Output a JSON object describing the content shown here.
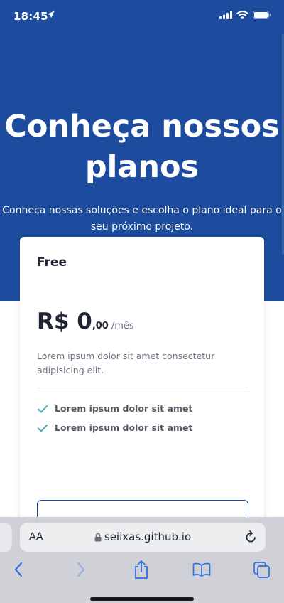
{
  "status_bar": {
    "time": "18:45"
  },
  "hero": {
    "title": "Conheça nossos planos",
    "subtitle": "Conheça nossas soluções e escolha o plano ideal para o seu próximo projeto."
  },
  "plan": {
    "name": "Free",
    "price_main": "R$ 0",
    "price_cents": ",00",
    "price_period": "/mês",
    "description": "Lorem ipsum dolor sit amet consectetur adipisicing elit.",
    "features": [
      "Lorem ipsum dolor sit amet",
      "Lorem ipsum dolor sit amet"
    ]
  },
  "browser": {
    "url": "seiixas.github.io",
    "text_size_label": "AA"
  },
  "colors": {
    "brand": "#1d4c9e",
    "check": "#4aa5b8",
    "toolbar_icon": "#2f6fe0"
  }
}
